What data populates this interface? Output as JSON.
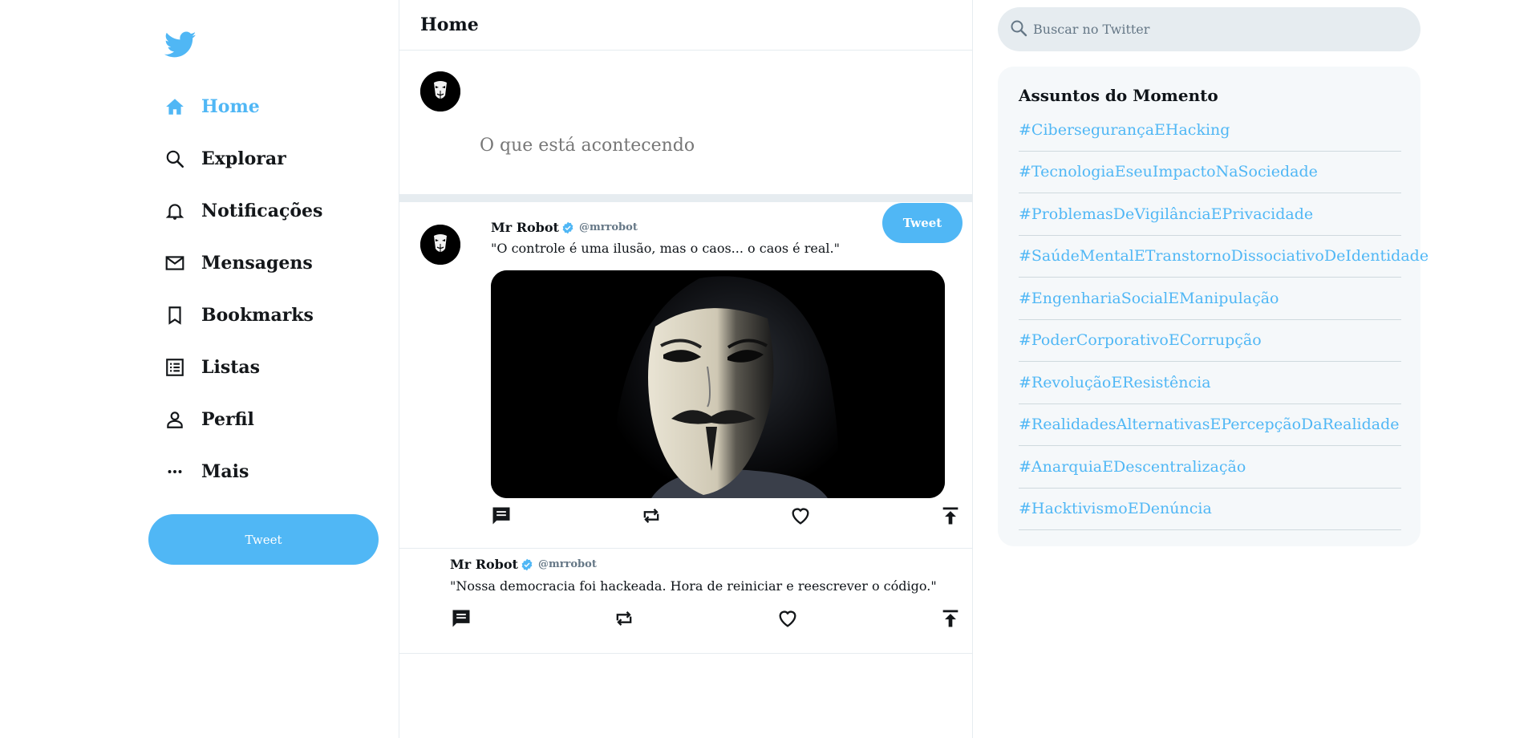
{
  "app": {
    "icons": {
      "logo": "twitter-bird-icon"
    },
    "brand_color": "#50b7f5"
  },
  "sidebar": {
    "items": [
      {
        "label": "Home",
        "icon": "home-icon",
        "active": true
      },
      {
        "label": "Explorar",
        "icon": "search-icon",
        "active": false
      },
      {
        "label": "Notificações",
        "icon": "bell-icon",
        "active": false
      },
      {
        "label": "Mensagens",
        "icon": "mail-icon",
        "active": false
      },
      {
        "label": "Bookmarks",
        "icon": "bookmark-icon",
        "active": false
      },
      {
        "label": "Listas",
        "icon": "list-icon",
        "active": false
      },
      {
        "label": "Perfil",
        "icon": "person-icon",
        "active": false
      },
      {
        "label": "Mais",
        "icon": "more-icon",
        "active": false
      }
    ],
    "tweet_button": "Tweet"
  },
  "feed": {
    "title": "Home",
    "compose": {
      "placeholder": "O que está acontecendo",
      "tweet_button": "Tweet"
    },
    "posts": [
      {
        "display_name": "Mr Robot",
        "handle": "@mrrobot",
        "verified": true,
        "text": "\"O controle é uma ilusão, mas o caos... o caos é real.\"",
        "has_image": true
      },
      {
        "display_name": "Mr Robot",
        "handle": "@mrrobot",
        "verified": true,
        "text": "\"Nossa democracia foi hackeada. Hora de reiniciar e reescrever o código.\"",
        "has_image": false
      }
    ]
  },
  "search": {
    "placeholder": "Buscar no Twitter"
  },
  "trends": {
    "title": "Assuntos do Momento",
    "items": [
      "#CibersegurançaEHacking",
      "#TecnologiaEseuImpactoNaSociedade",
      "#ProblemasDeVigilânciaEPrivacidade",
      "#SaúdeMentalETranstornoDissociativoDeIdentidade",
      "#EngenhariaSocialEManipulação",
      "#PoderCorporativoECorrupção",
      "#RevoluçãoEResistência",
      "#RealidadesAlternativasEPercepçãoDaRealidade",
      "#AnarquiaEDescentralização",
      "#HacktivismoEDenúncia"
    ]
  }
}
